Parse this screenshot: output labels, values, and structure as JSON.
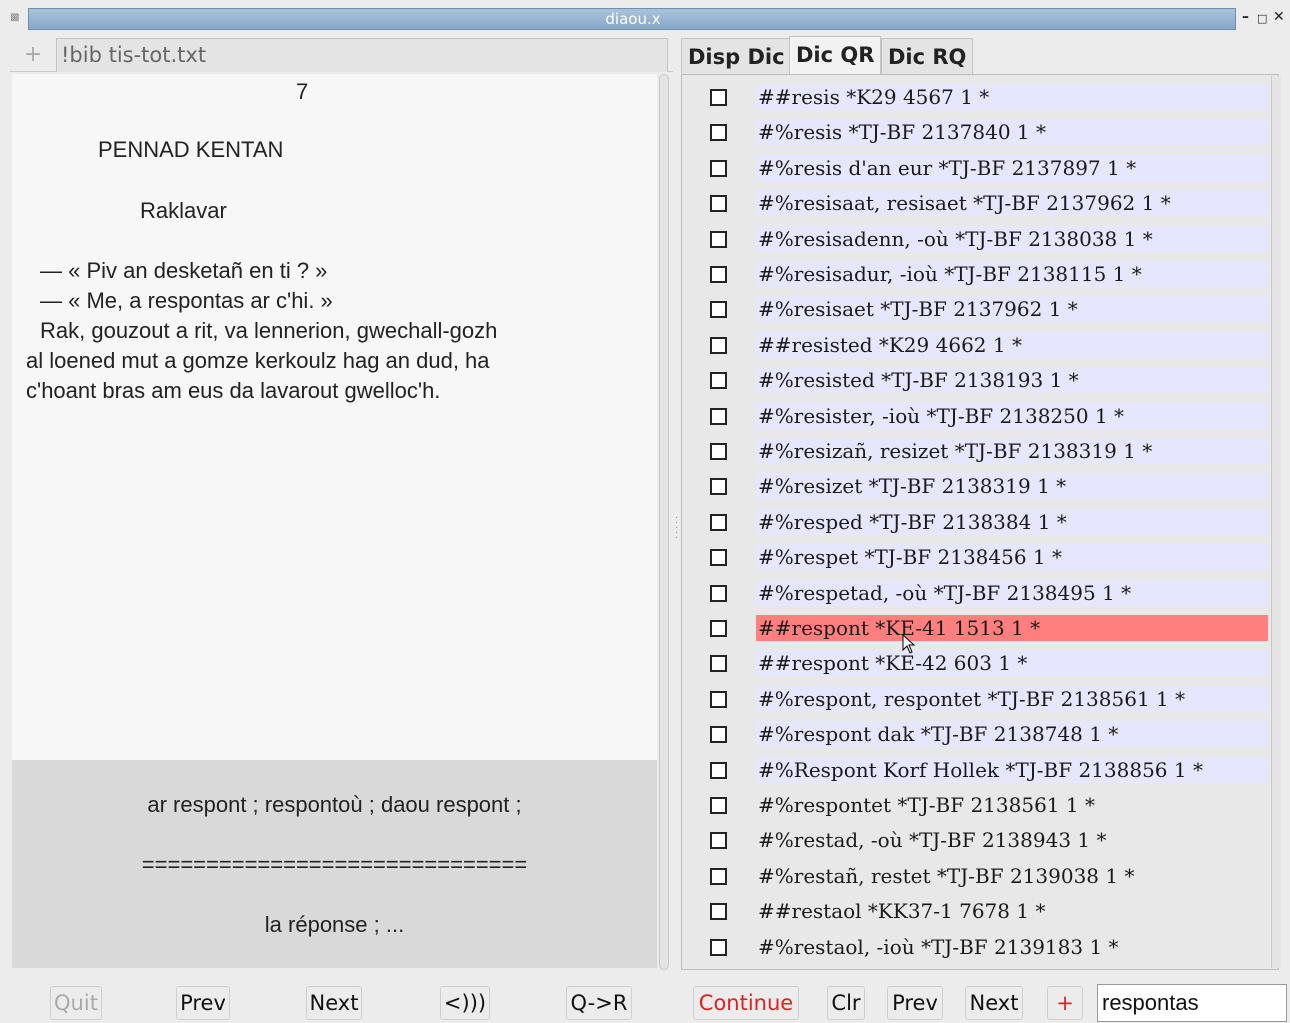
{
  "window": {
    "title": "diaou.x"
  },
  "left": {
    "tab_plus": "+",
    "file_tab": "!bib tis-tot.txt",
    "text_lines": [
      "7",
      "PENNAD KENTAN",
      "Raklavar",
      "— « Piv an desketañ en ti ? »",
      "— « Me, a respontas ar c'hi. »",
      "Rak, gouzout a rit, va lennerion, gwechall-gozh",
      "al loened mut a gomze kerkoulz hag an dud, ha",
      "c'hoant bras am eus da lavarout gwelloc'h."
    ],
    "lower_lines": [
      "ar respont ; respontoù ; daou respont ;",
      "==============================",
      "la réponse ; ..."
    ],
    "buttons": {
      "quit": "Quit",
      "prev": "Prev",
      "next": "Next",
      "sound": "<)))",
      "q_to_r": "Q->R"
    }
  },
  "right": {
    "tabs": [
      "Disp Dic",
      "Dic QR",
      "Dic RQ"
    ],
    "active_tab": "Dic QR",
    "entries": [
      "##resis *K29 4567 1 *",
      "#%resis *TJ-BF 2137840  1 *",
      "#%resis d'an eur *TJ-BF 2137897  1 *",
      "#%resisaat, resisaet *TJ-BF 2137962  1 *",
      "#%resisadenn, -où *TJ-BF 2138038  1 *",
      "#%resisadur, -ioù *TJ-BF 2138115  1 *",
      "#%resisaet *TJ-BF 2137962  1 *",
      "##resisted *K29 4662 1 *",
      "#%resisted *TJ-BF 2138193  1 *",
      "#%resister, -ioù *TJ-BF 2138250  1 *",
      "#%resizañ, resizet *TJ-BF 2138319  1 *",
      "#%resizet *TJ-BF 2138319  1 *",
      "#%resped *TJ-BF 2138384  1 *",
      "#%respet *TJ-BF 2138456  1 *",
      "#%respetad, -où *TJ-BF 2138495  1 *",
      "##respont *KE-41 1513 1 *",
      "##respont *KE-42 603 1 *",
      "#%respont, respontet *TJ-BF 2138561  1 *",
      "#%respont dak *TJ-BF 2138748  1 *",
      "#%Respont Korf Hollek *TJ-BF 2138856  1 *",
      "#%respontet *TJ-BF 2138561  1 *",
      "#%restad, -où *TJ-BF 2138943  1 *",
      "#%restañ, restet *TJ-BF 2139038  1 *",
      "##restaol *KK37-1 7678 1 *",
      "#%restaol, -ioù *TJ-BF 2139183  1 *"
    ],
    "selected_index": 15,
    "highlighted_count": 20,
    "buttons": {
      "continue": "Continue",
      "clr": "Clr",
      "prev": "Prev",
      "next": "Next",
      "plus": "+"
    },
    "search_value": "respontas"
  },
  "colors": {
    "selected_row": "#ff7f7f",
    "row_bg": "#e6e6ff",
    "continue_text": "#e02020"
  }
}
